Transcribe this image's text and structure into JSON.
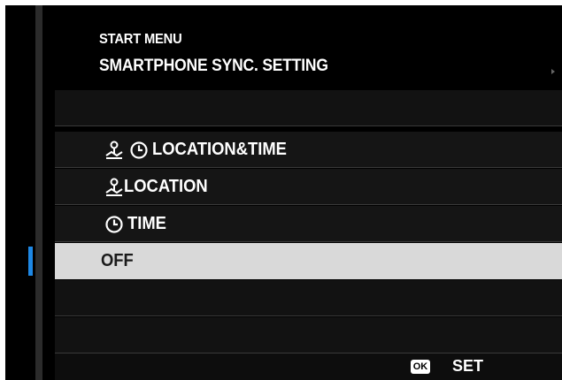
{
  "header": {
    "menu_title": "START MENU",
    "setting_title": "SMARTPHONE SYNC. SETTING"
  },
  "menu": {
    "items": [
      {
        "label": "LOCATION&TIME",
        "icons": [
          "location-icon",
          "clock-icon"
        ],
        "selected": false
      },
      {
        "label": "LOCATION",
        "icons": [
          "location-icon"
        ],
        "selected": false
      },
      {
        "label": "TIME",
        "icons": [
          "clock-icon"
        ],
        "selected": false
      },
      {
        "label": "OFF",
        "icons": [],
        "selected": true
      }
    ]
  },
  "footer": {
    "ok_key": "OK",
    "set_label": "SET"
  },
  "colors": {
    "background": "#000000",
    "row": "#151515",
    "selected_row": "#d9d9d9",
    "cursor_accent": "#1e88e5"
  }
}
